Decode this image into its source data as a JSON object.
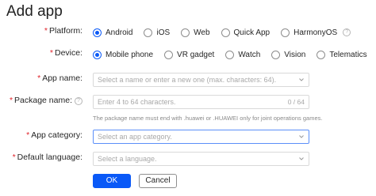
{
  "page": {
    "title": "Add app"
  },
  "platform": {
    "label": "Platform:",
    "options": [
      "Android",
      "iOS",
      "Web",
      "Quick App",
      "HarmonyOS"
    ],
    "selected": "Android"
  },
  "device": {
    "label": "Device:",
    "options": [
      "Mobile phone",
      "VR gadget",
      "Watch",
      "Vision",
      "Telematics"
    ],
    "selected": "Mobile phone"
  },
  "app_name": {
    "label": "App name:",
    "placeholder": "Select a name or enter a new one (max. characters: 64)."
  },
  "package_name": {
    "label": "Package name:",
    "placeholder": "Enter 4 to 64 characters.",
    "counter": "0 / 64",
    "hint": "The package name must end with .huawei or .HUAWEI only for joint operations games."
  },
  "app_category": {
    "label": "App category:",
    "placeholder": "Select an app category."
  },
  "default_language": {
    "label": "Default language:",
    "placeholder": "Select a language."
  },
  "buttons": {
    "ok": "OK",
    "cancel": "Cancel"
  },
  "colors": {
    "accent": "#0a59f7",
    "required": "#e0242b"
  },
  "icons": {
    "select_arrow": "chevron-down-icon",
    "help": "help-icon"
  }
}
